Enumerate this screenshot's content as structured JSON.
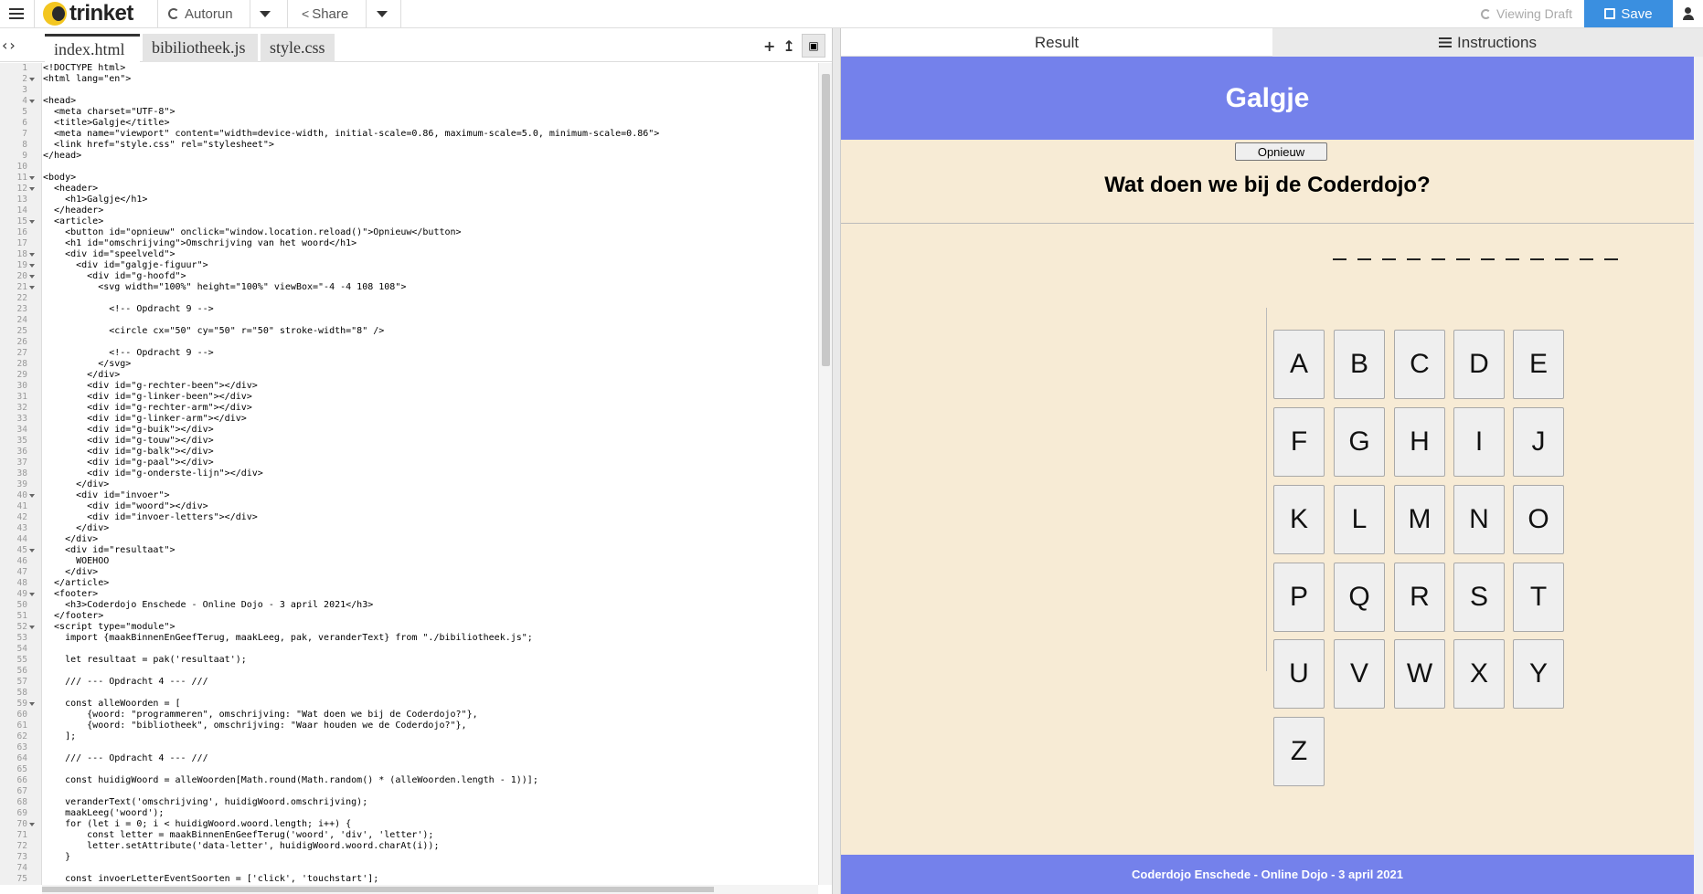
{
  "topbar": {
    "logo": "trinket",
    "autorun_label": "Autorun",
    "share_label": "Share",
    "viewing_draft": "Viewing Draft",
    "save_label": "Save"
  },
  "editor": {
    "tabs": [
      "index.html",
      "bibiliotheek.js",
      "style.css"
    ],
    "active_tab": 0,
    "code": [
      "<!DOCTYPE html>",
      "<html lang=\"en\">",
      "",
      "<head>",
      "  <meta charset=\"UTF-8\">",
      "  <title>Galgje</title>",
      "  <meta name=\"viewport\" content=\"width=device-width, initial-scale=0.86, maximum-scale=5.0, minimum-scale=0.86\">",
      "  <link href=\"style.css\" rel=\"stylesheet\">",
      "</head>",
      "",
      "<body>",
      "  <header>",
      "    <h1>Galgje</h1>",
      "  </header>",
      "  <article>",
      "    <button id=\"opnieuw\" onclick=\"window.location.reload()\">Opnieuw</button>",
      "    <h1 id=\"omschrijving\">Omschrijving van het woord</h1>",
      "    <div id=\"speelveld\">",
      "      <div id=\"galgje-figuur\">",
      "        <div id=\"g-hoofd\">",
      "          <svg width=\"100%\" height=\"100%\" viewBox=\"-4 -4 108 108\">",
      "",
      "            <!-- Opdracht 9 -->",
      "",
      "            <circle cx=\"50\" cy=\"50\" r=\"50\" stroke-width=\"8\" />",
      "",
      "            <!-- Opdracht 9 -->",
      "          </svg>",
      "        </div>",
      "        <div id=\"g-rechter-been\"></div>",
      "        <div id=\"g-linker-been\"></div>",
      "        <div id=\"g-rechter-arm\"></div>",
      "        <div id=\"g-linker-arm\"></div>",
      "        <div id=\"g-buik\"></div>",
      "        <div id=\"g-touw\"></div>",
      "        <div id=\"g-balk\"></div>",
      "        <div id=\"g-paal\"></div>",
      "        <div id=\"g-onderste-lijn\"></div>",
      "      </div>",
      "      <div id=\"invoer\">",
      "        <div id=\"woord\"></div>",
      "        <div id=\"invoer-letters\"></div>",
      "      </div>",
      "    </div>",
      "    <div id=\"resultaat\">",
      "      WOEHOO",
      "    </div>",
      "  </article>",
      "  <footer>",
      "    <h3>Coderdojo Enschede - Online Dojo - 3 april 2021</h3>",
      "  </footer>",
      "  <script type=\"module\">",
      "    import {maakBinnenEnGeefTerug, maakLeeg, pak, veranderText} from \"./bibiliotheek.js\";",
      "",
      "    let resultaat = pak('resultaat');",
      "",
      "    /// --- Opdracht 4 --- ///",
      "",
      "    const alleWoorden = [",
      "        {woord: \"programmeren\", omschrijving: \"Wat doen we bij de Coderdojo?\"},",
      "        {woord: \"bibliotheek\", omschrijving: \"Waar houden we de Coderdojo?\"},",
      "    ];",
      "",
      "    /// --- Opdracht 4 --- ///",
      "",
      "    const huidigWoord = alleWoorden[Math.round(Math.random() * (alleWoorden.length - 1))];",
      "",
      "    veranderText('omschrijving', huidigWoord.omschrijving);",
      "    maakLeeg('woord');",
      "    for (let i = 0; i < huidigWoord.woord.length; i++) {",
      "        const letter = maakBinnenEnGeefTerug('woord', 'div', 'letter');",
      "        letter.setAttribute('data-letter', huidigWoord.woord.charAt(i));",
      "    }",
      "",
      "    const invoerLetterEventSoorten = ['click', 'touchstart'];",
      ""
    ],
    "fold_lines": [
      2,
      4,
      11,
      12,
      15,
      18,
      19,
      20,
      21,
      40,
      45,
      49,
      52,
      59,
      70
    ]
  },
  "result": {
    "tab_result": "Result",
    "tab_instructions": "Instructions",
    "page_title": "Galgje",
    "restart_button": "Opnieuw",
    "question": "Wat doen we bij de Coderdojo?",
    "blanks_count": 12,
    "letters": [
      "A",
      "B",
      "C",
      "D",
      "E",
      "F",
      "G",
      "H",
      "I",
      "J",
      "K",
      "L",
      "M",
      "N",
      "O",
      "P",
      "Q",
      "R",
      "S",
      "T",
      "U",
      "V",
      "W",
      "X",
      "Y",
      "Z"
    ],
    "footer": "Coderdojo Enschede - Online Dojo - 3 april 2021"
  },
  "colors": {
    "header_bg": "#7481eb",
    "page_bg": "#f7ebd5",
    "save_bg": "#3a8fe0"
  }
}
